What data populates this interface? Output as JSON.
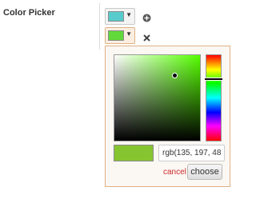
{
  "field": {
    "label": "Color Picker"
  },
  "swatches": [
    {
      "color": "#58cccc",
      "caret": "▼"
    },
    {
      "color": "#61d93a",
      "caret": "▼"
    }
  ],
  "icons": {
    "add": "add-circle-icon",
    "remove": "close-x-icon"
  },
  "picker": {
    "base_hue": "#55ff00",
    "hue_fraction": 0.28,
    "saturation": 0.7,
    "brightness": 0.77,
    "selected_color": "#87c530",
    "value": "rgb(135, 197, 48",
    "cancel_label": "cancel",
    "choose_label": "choose"
  }
}
